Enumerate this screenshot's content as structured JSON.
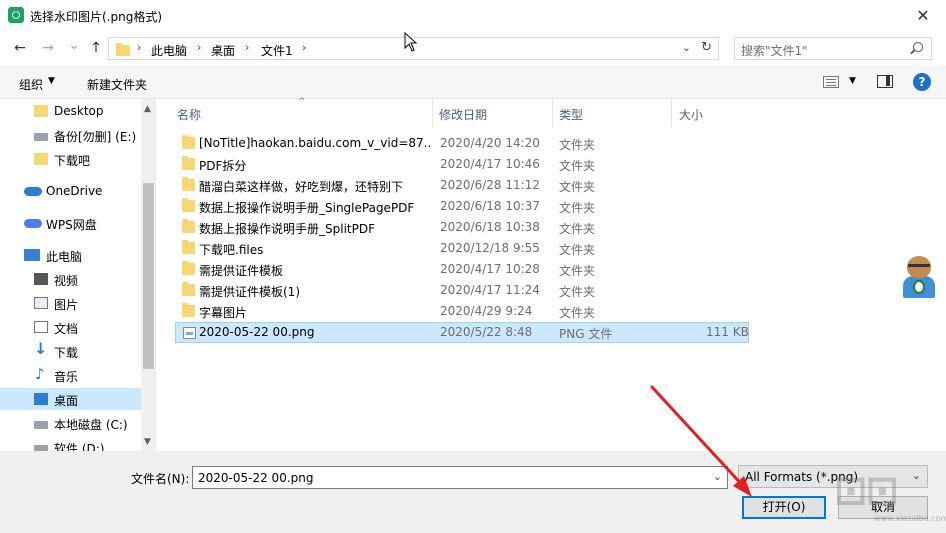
{
  "window": {
    "title": "选择水印图片(.png格式)",
    "close_glyph": "✕"
  },
  "nav": {
    "back_glyph": "←",
    "forward_glyph": "→",
    "recent_glyph": "⌄",
    "up_glyph": "↑"
  },
  "address": {
    "crumbs": [
      "此电脑",
      "桌面",
      "文件1"
    ],
    "sep_glyph": "›",
    "dropdown_glyph": "⌄",
    "refresh_glyph": "↻"
  },
  "search": {
    "placeholder": "搜索\"文件1\""
  },
  "toolbar": {
    "organize_label": "组织",
    "organize_caret": "▼",
    "new_folder_label": "新建文件夹",
    "view_caret": "▼",
    "help_glyph": "?"
  },
  "sidebar": {
    "items": [
      {
        "label": "Desktop",
        "icon": "folder-icon"
      },
      {
        "label": "备份[勿删] (E:)",
        "icon": "drive-icon"
      },
      {
        "label": "下载吧",
        "icon": "folder-icon"
      },
      {
        "label": "OneDrive",
        "icon": "cloud-icon"
      },
      {
        "label": "WPS网盘",
        "icon": "cloud-icon"
      },
      {
        "label": "此电脑",
        "icon": "computer-icon"
      },
      {
        "label": "视频",
        "icon": "video-icon"
      },
      {
        "label": "图片",
        "icon": "pictures-icon"
      },
      {
        "label": "文档",
        "icon": "documents-icon"
      },
      {
        "label": "下载",
        "icon": "download-icon"
      },
      {
        "label": "音乐",
        "icon": "music-icon"
      },
      {
        "label": "桌面",
        "icon": "desktop-icon"
      },
      {
        "label": "本地磁盘 (C:)",
        "icon": "drive-icon"
      },
      {
        "label": "软件 (D:)",
        "icon": "drive-icon"
      }
    ],
    "selected_index": 11,
    "scroll_up": "▲",
    "scroll_down": "▼"
  },
  "columns": {
    "name": "名称",
    "modified": "修改日期",
    "type": "类型",
    "size": "大小",
    "sort_caret": "^"
  },
  "files": [
    {
      "name": "[NoTitle]haokan.baidu.com_v_vid=87...",
      "modified": "2020/4/20 14:20",
      "type": "文件夹",
      "size": "",
      "kind": "folder"
    },
    {
      "name": "PDF拆分",
      "modified": "2020/4/17 10:46",
      "type": "文件夹",
      "size": "",
      "kind": "folder"
    },
    {
      "name": "醋溜白菜这样做，好吃到爆，还特别下",
      "modified": "2020/6/28 11:12",
      "type": "文件夹",
      "size": "",
      "kind": "folder"
    },
    {
      "name": "数据上报操作说明手册_SinglePagePDF",
      "modified": "2020/6/18 10:37",
      "type": "文件夹",
      "size": "",
      "kind": "folder"
    },
    {
      "name": "数据上报操作说明手册_SplitPDF",
      "modified": "2020/6/18 10:38",
      "type": "文件夹",
      "size": "",
      "kind": "folder"
    },
    {
      "name": "下载吧.files",
      "modified": "2020/12/18 9:55",
      "type": "文件夹",
      "size": "",
      "kind": "folder"
    },
    {
      "name": "需提供证件模板",
      "modified": "2020/4/17 10:28",
      "type": "文件夹",
      "size": "",
      "kind": "folder"
    },
    {
      "name": "需提供证件模板(1)",
      "modified": "2020/4/17 11:24",
      "type": "文件夹",
      "size": "",
      "kind": "folder"
    },
    {
      "name": "字幕图片",
      "modified": "2020/4/29 9:24",
      "type": "文件夹",
      "size": "",
      "kind": "folder"
    },
    {
      "name": "2020-05-22 00.png",
      "modified": "2020/5/22 8:48",
      "type": "PNG 文件",
      "size": "111 KB",
      "kind": "image"
    }
  ],
  "selected_file_index": 9,
  "bottom": {
    "filename_label": "文件名(N):",
    "filename_value": "2020-05-22 00.png",
    "filename_drop": "⌄",
    "filetype_value": "All Formats (*.png)",
    "filetype_drop": "⌄",
    "open_label": "打开(O)",
    "cancel_label": "取消"
  },
  "colors": {
    "selection": "#cce8ff",
    "accent": "#0078d7",
    "annotation_arrow": "#e02020"
  },
  "watermark": {
    "url": "www.xiazaiba.com"
  }
}
